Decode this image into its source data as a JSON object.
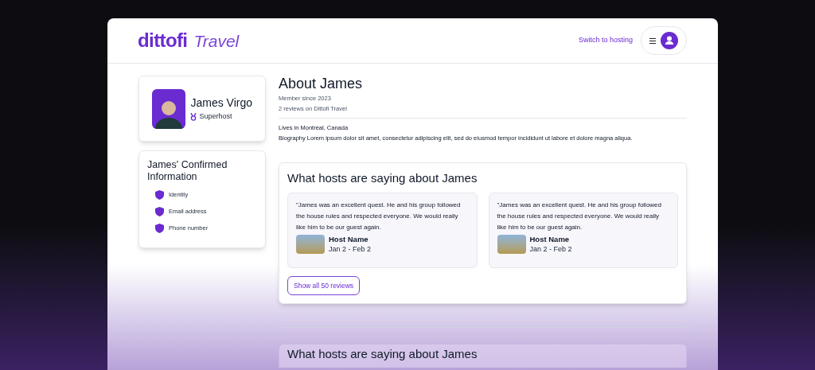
{
  "brand": {
    "logo": "dittofi",
    "product": "Travel"
  },
  "header": {
    "switch_link": "Switch to hosting"
  },
  "profile": {
    "name": "James Virgo",
    "badge": "Superhost"
  },
  "confirmed": {
    "title": "James' Confirmed Information",
    "items": [
      "Identity",
      "Email address",
      "Phone number"
    ]
  },
  "about": {
    "title": "About James",
    "meta": [
      "Member since 2023",
      "2 reviews on Dittofi Travel"
    ],
    "location": "Lives in Montreal, Canada",
    "bio": "Biography Lorem ipsum dolor sit amet, consectetur adipiscing elit, sed do eiusmod tempor incididunt ut labore et dolore magna aliqua."
  },
  "reviews_section": {
    "title": "What hosts are saying about James",
    "reviews": [
      {
        "quote": "\"James was an excellent quest. He and his group followed the house rules and respected everyone. We would really like him to be our guest again.",
        "host": "Host Name",
        "dates": "Jan 2 - Feb 2"
      },
      {
        "quote": "\"James was an excellent quest. He and his group followed the house rules and respected everyone. We would really like him to be our guest again.",
        "host": "Host Name",
        "dates": "Jan 2 - Feb 2"
      }
    ],
    "button": "Show all 50 reviews"
  },
  "next_section": {
    "title": "What hosts are saying about James"
  }
}
